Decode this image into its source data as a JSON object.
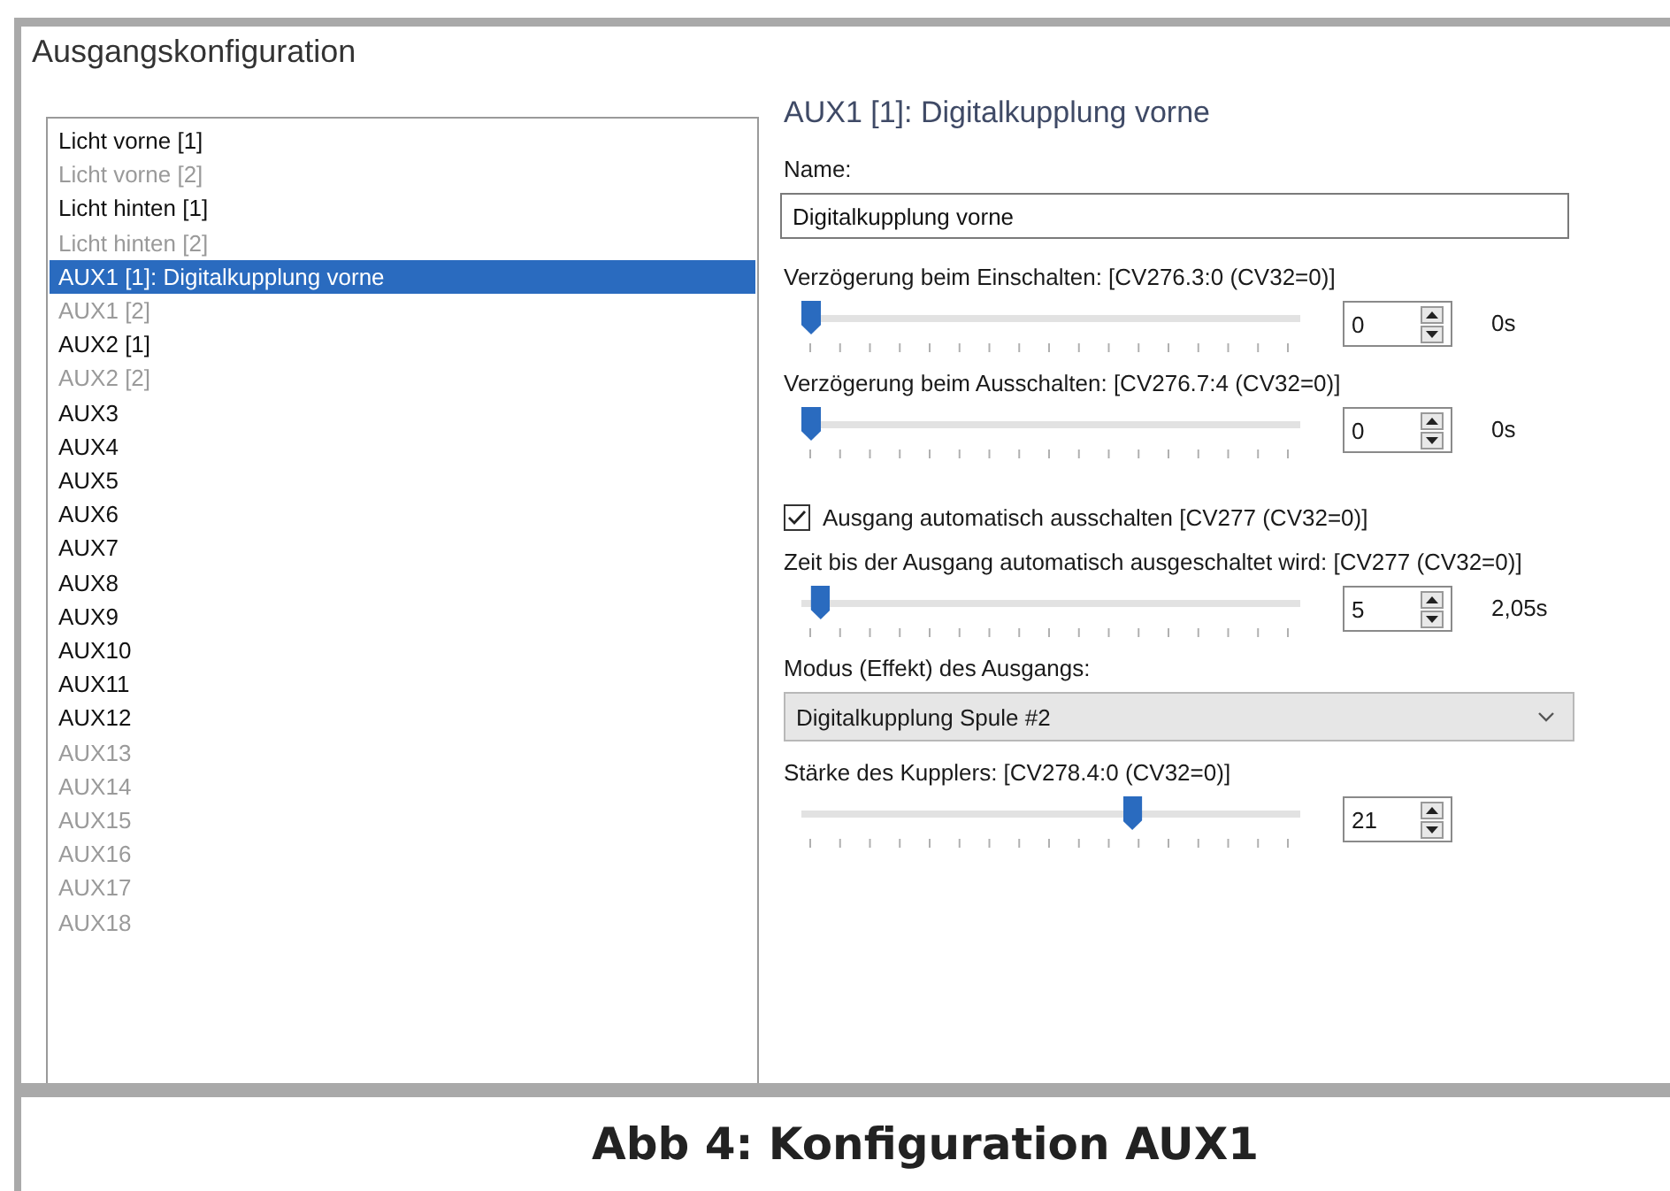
{
  "window": {
    "title": "Ausgangskonfiguration"
  },
  "outputs": [
    {
      "label": "Licht vorne [1]",
      "disabled": false,
      "selected": false
    },
    {
      "label": "Licht vorne [2]",
      "disabled": true,
      "selected": false
    },
    {
      "label": "Licht hinten [1]",
      "disabled": false,
      "selected": false
    },
    {
      "label": "Licht hinten [2]",
      "disabled": true,
      "selected": false
    },
    {
      "label": "AUX1 [1]: Digitalkupplung vorne",
      "disabled": false,
      "selected": true
    },
    {
      "label": "AUX1 [2]",
      "disabled": true,
      "selected": false
    },
    {
      "label": "AUX2 [1]",
      "disabled": false,
      "selected": false
    },
    {
      "label": "AUX2 [2]",
      "disabled": true,
      "selected": false
    },
    {
      "label": "AUX3",
      "disabled": false,
      "selected": false
    },
    {
      "label": "AUX4",
      "disabled": false,
      "selected": false
    },
    {
      "label": "AUX5",
      "disabled": false,
      "selected": false
    },
    {
      "label": "AUX6",
      "disabled": false,
      "selected": false
    },
    {
      "label": "AUX7",
      "disabled": false,
      "selected": false
    },
    {
      "label": "AUX8",
      "disabled": false,
      "selected": false
    },
    {
      "label": "AUX9",
      "disabled": false,
      "selected": false
    },
    {
      "label": "AUX10",
      "disabled": false,
      "selected": false
    },
    {
      "label": "AUX11",
      "disabled": false,
      "selected": false
    },
    {
      "label": "AUX12",
      "disabled": false,
      "selected": false
    },
    {
      "label": "AUX13",
      "disabled": true,
      "selected": false
    },
    {
      "label": "AUX14",
      "disabled": true,
      "selected": false
    },
    {
      "label": "AUX15",
      "disabled": true,
      "selected": false
    },
    {
      "label": "AUX16",
      "disabled": true,
      "selected": false
    },
    {
      "label": "AUX17",
      "disabled": true,
      "selected": false
    },
    {
      "label": "AUX18",
      "disabled": true,
      "selected": false
    }
  ],
  "detail": {
    "heading": "AUX1 [1]: Digitalkupplung vorne",
    "name_label": "Name:",
    "name_value": "Digitalkupplung vorne",
    "controls": [
      {
        "kind": "slider",
        "label": "Verzögerung beim Einschalten: [CV276.3:0 (CV32=0)]",
        "level": 0,
        "value": "0",
        "reading": "0s"
      },
      {
        "kind": "slider",
        "label": "Verzögerung beim Ausschalten: [CV276.7:4 (CV32=0)]",
        "level": 0,
        "value": "0",
        "reading": "0s"
      },
      {
        "kind": "checkbox",
        "label": "Ausgang automatisch ausschalten [CV277 (CV32=0)]",
        "checked": true
      },
      {
        "kind": "slider",
        "label": "Zeit bis der Ausgang automatisch ausgeschaltet wird: [CV277 (CV32=0)]",
        "level": 0.02,
        "value": "5",
        "reading": "2,05s"
      },
      {
        "kind": "dropdown",
        "label": "Modus (Effekt) des Ausgangs:",
        "value": "Digitalkupplung Spule #2"
      },
      {
        "kind": "slider",
        "label": "Stärke des Kupplers: [CV278.4:0 (CV32=0)]",
        "level": 0.67,
        "value": "21"
      }
    ]
  },
  "caption": "Abb 4: Konfiguration AUX1"
}
